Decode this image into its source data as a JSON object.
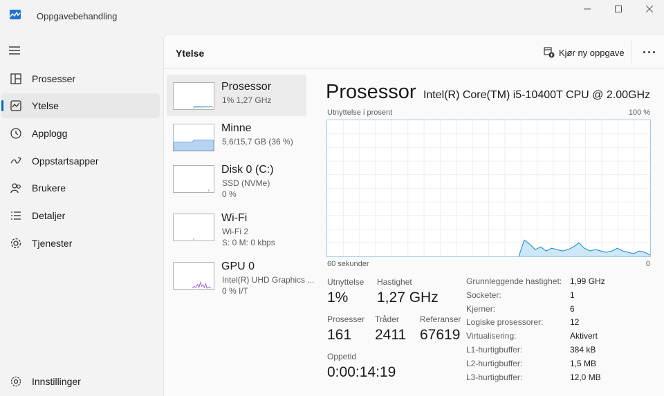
{
  "window": {
    "title": "Oppgavebehandling",
    "controls": [
      "minimize-icon",
      "maximize-icon",
      "close-icon"
    ]
  },
  "sidebar": {
    "items": [
      {
        "label": "Prosesser",
        "icon": "processes-icon",
        "active": false
      },
      {
        "label": "Ytelse",
        "icon": "performance-icon",
        "active": true
      },
      {
        "label": "Applogg",
        "icon": "app-history-icon",
        "active": false
      },
      {
        "label": "Oppstartsapper",
        "icon": "startup-apps-icon",
        "active": false
      },
      {
        "label": "Brukere",
        "icon": "users-icon",
        "active": false
      },
      {
        "label": "Detaljer",
        "icon": "details-icon",
        "active": false
      },
      {
        "label": "Tjenester",
        "icon": "services-icon",
        "active": false
      }
    ],
    "settings_label": "Innstillinger"
  },
  "header": {
    "title": "Ytelse",
    "run_task_label": "Kjør ny oppgave",
    "more_label": "···"
  },
  "devices": [
    {
      "name": "Prosessor",
      "sub1": "1%  1,27 GHz",
      "sub2": "",
      "color": "#1187c9",
      "active": true
    },
    {
      "name": "Minne",
      "sub1": "5,6/15,7 GB (36 %)",
      "sub2": "",
      "color": "#4f8fd9",
      "active": false
    },
    {
      "name": "Disk 0 (C:)",
      "sub1": "SSD (NVMe)",
      "sub2": "0 %",
      "color": "#4ca64c",
      "active": false
    },
    {
      "name": "Wi-Fi",
      "sub1": "Wi-Fi 2",
      "sub2": "S:  0  M:  0 kbps",
      "color": "#a74ea7",
      "active": false
    },
    {
      "name": "GPU 0",
      "sub1": "Intel(R) UHD Graphics ...",
      "sub2": "0 %  I/T",
      "color": "#8e4fd1",
      "active": false
    }
  ],
  "detail": {
    "title": "Prosessor",
    "model": "Intel(R) Core(TM) i5-10400T CPU @ 2.00GHz",
    "graph_label_left": "Utnyttelse i prosent",
    "graph_label_right": "100 %",
    "graph_axis_left": "60 sekunder",
    "graph_axis_right": "0",
    "stats": {
      "util_label": "Utnyttelse",
      "util_value": "1%",
      "speed_label": "Hastighet",
      "speed_value": "1,27 GHz",
      "proc_label": "Prosesser",
      "proc_value": "161",
      "threads_label": "Tråder",
      "threads_value": "2411",
      "handles_label": "Referanser",
      "handles_value": "67619",
      "uptime_label": "Oppetid",
      "uptime_value": "0:00:14:19"
    },
    "properties": [
      {
        "key": "Grunnleggende hastighet:",
        "value": "1,99 GHz"
      },
      {
        "key": "Socketer:",
        "value": "1"
      },
      {
        "key": "Kjerner:",
        "value": "6"
      },
      {
        "key": "Logiske prosessorer:",
        "value": "12"
      },
      {
        "key": "Virtualisering:",
        "value": "Aktivert"
      },
      {
        "key": "L1-hurtigbuffer:",
        "value": "384 kB"
      },
      {
        "key": "L2-hurtigbuffer:",
        "value": "1,5 MB"
      },
      {
        "key": "L3-hurtigbuffer:",
        "value": "12,0 MB"
      }
    ],
    "cpu_history_percent": [
      0,
      0,
      0,
      0,
      0,
      0,
      0,
      0,
      0,
      0,
      0,
      0,
      0,
      0,
      0,
      0,
      0,
      0,
      0,
      0,
      0,
      0,
      0,
      0,
      0,
      0,
      0,
      0,
      0,
      0,
      0,
      0,
      0,
      0,
      0,
      0,
      12,
      9,
      5,
      7,
      4,
      6,
      5,
      4,
      5,
      7,
      10,
      6,
      4,
      5,
      4,
      3,
      4,
      6,
      4,
      3,
      2,
      4,
      3,
      1
    ],
    "accent": "#1187c9"
  }
}
